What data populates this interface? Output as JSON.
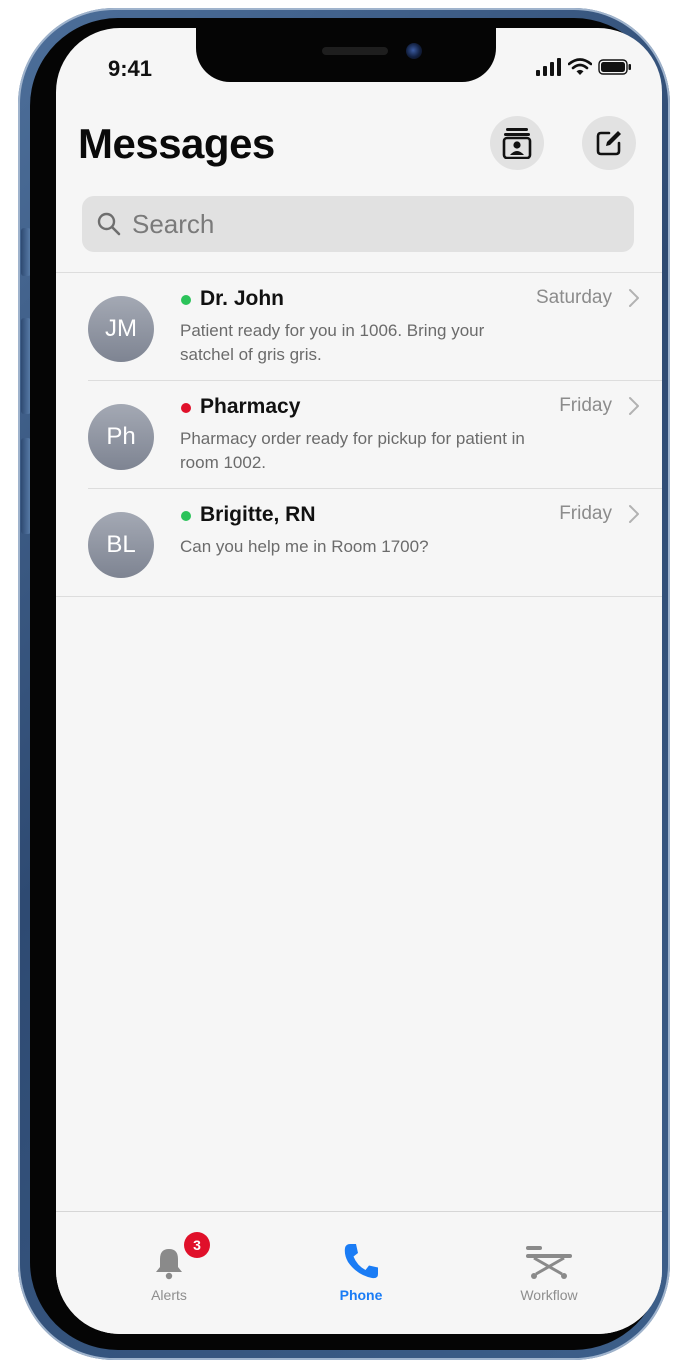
{
  "status_bar": {
    "time": "9:41"
  },
  "header": {
    "title": "Messages",
    "contacts_icon": "contacts-book-icon",
    "compose_icon": "compose-icon"
  },
  "search": {
    "placeholder": "Search",
    "value": ""
  },
  "conversations": [
    {
      "initials": "JM",
      "name": "Dr. John",
      "status_color": "#2bc35a",
      "preview": "Patient ready for you in 1006. Bring your satchel of gris gris.",
      "date": "Saturday"
    },
    {
      "initials": "Ph",
      "name": "Pharmacy",
      "status_color": "#e0102a",
      "preview": "Pharmacy order ready for pickup for patient in room 1002.",
      "date": "Friday"
    },
    {
      "initials": "BL",
      "name": "Brigitte, RN",
      "status_color": "#2bc35a",
      "preview": "Can you help me in Room 1700?",
      "date": "Friday"
    }
  ],
  "tabbar": {
    "tabs": [
      {
        "label": "Alerts",
        "icon": "bell-icon",
        "badge": "3",
        "active": false
      },
      {
        "label": "Phone",
        "icon": "phone-icon",
        "active": true
      },
      {
        "label": "Workflow",
        "icon": "stretcher-icon",
        "active": false
      }
    ]
  },
  "colors": {
    "accent": "#1a7cf5",
    "badge": "#e0102a",
    "online": "#2bc35a",
    "busy": "#e0102a"
  }
}
